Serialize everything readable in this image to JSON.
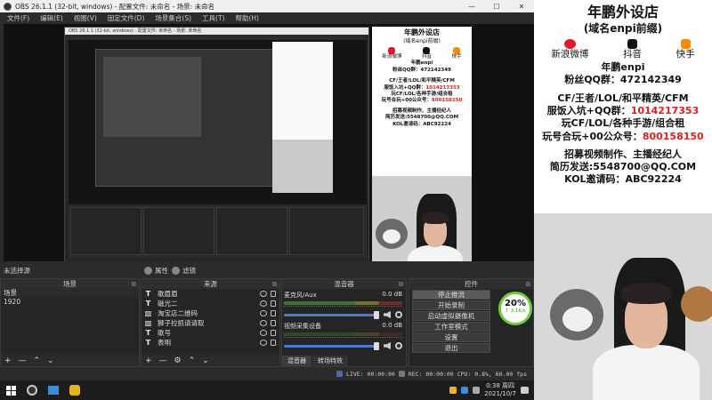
{
  "window": {
    "title": "OBS 26.1.1 (32-bit, windows) - 配置文件: 未命名 - 场景: 未命名",
    "controls": [
      "—",
      "☐",
      "✕"
    ]
  },
  "menu": [
    "文件(F)",
    "编辑(E)",
    "视图(V)",
    "固定文件(D)",
    "场景集合(S)",
    "工具(T)",
    "帮助(H)"
  ],
  "nested_title": "OBS 26.1.1 (32-bit, windows) - 配置文件: 未命名 - 场景: 未命名",
  "toolbar": {
    "no_source": "未选择源",
    "properties": "属性",
    "filters": "滤镜"
  },
  "scenes": {
    "title": "场景",
    "items": [
      "场景",
      "1920"
    ],
    "selected": 0
  },
  "sources": {
    "title": "来源",
    "items": [
      {
        "label": "歌眉眉",
        "icon": "text-icon"
      },
      {
        "label": "磁光二",
        "icon": "text-icon"
      },
      {
        "label": "淘宝店二维码",
        "icon": "image-icon"
      },
      {
        "label": "狮子拉抓请请取",
        "icon": "image-icon"
      },
      {
        "label": "歌号",
        "icon": "text-icon"
      },
      {
        "label": "表明",
        "icon": "text-icon"
      }
    ]
  },
  "mixer": {
    "title": "混音器",
    "channels": [
      {
        "name": "麦克风/Aux",
        "db": "0.0 dB"
      },
      {
        "name": "视频采集设备",
        "db": "0.0 dB"
      }
    ],
    "tabs": [
      "混音器",
      "转场特效"
    ]
  },
  "controls": {
    "title": "控件",
    "buttons": [
      "停止推流",
      "开始录制",
      "启动虚拟摄像机",
      "工作室模式",
      "设置",
      "退出"
    ]
  },
  "gauge": {
    "percent": "20%",
    "speed": "↑ 3.1K/s"
  },
  "status": {
    "live": "LIVE: 00:00:00",
    "rec": "REC: 00:00:00",
    "cpu": "CPU: 0.8%, 60.00 fps"
  },
  "ad": {
    "title": "年鹏外设店",
    "subtitle": "(域名enpi前缀)",
    "socials": [
      {
        "label": "新浪微博",
        "icon": "weibo-icon",
        "color": "#e6162d"
      },
      {
        "label": "抖音",
        "icon": "douyin-icon",
        "color": "#111111"
      },
      {
        "label": "快手",
        "icon": "kuaishou-icon",
        "color": "#ff8a00"
      }
    ],
    "handle": "年鹏enpi",
    "fans": "粉丝QQ群：472142349",
    "line1": "CF/王者/LOL/和平精英/CFM",
    "line2a": "服饭入坑+QQ群：",
    "line2b": "1014217353",
    "line3": "玩CF/LOL/各种手游/组合租",
    "line4a": "玩号合玩+00公众号：",
    "line4b": "800158150",
    "line5": "招募视频制作、主播经纪人",
    "line6": "简历发送:5548700@QQ.COM",
    "line7": "KOL邀请码：ABC92224"
  },
  "taskbar": {
    "time": "0:38 周四",
    "date": "2021/10/7"
  }
}
